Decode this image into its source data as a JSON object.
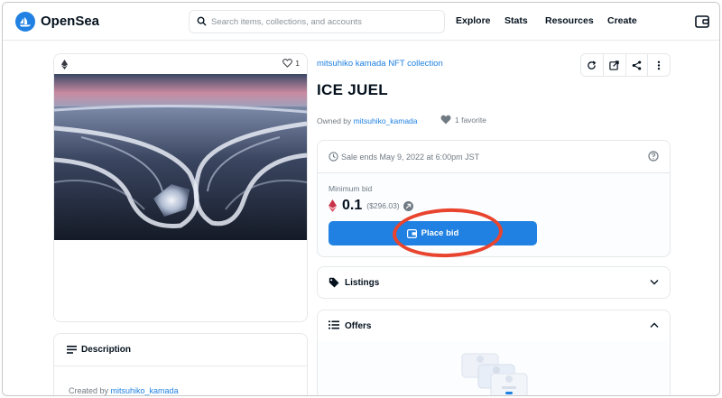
{
  "header": {
    "brand": "OpenSea",
    "search_placeholder": "Search items, collections, and accounts",
    "nav": [
      "Explore",
      "Stats",
      "Resources",
      "Create"
    ]
  },
  "media": {
    "favorite_count": "1"
  },
  "item": {
    "collection": "mitsuhiko kamada NFT collection",
    "title": "ICE JUEL",
    "owned_prefix": "Owned by ",
    "owner": "mitsuhiko_kamada",
    "favorites": "1 favorite"
  },
  "sale": {
    "ends": "Sale ends May 9, 2022 at 6:00pm JST",
    "min_bid_label": "Minimum bid",
    "price": "0.1",
    "usd": "($296.03)",
    "place_bid": "Place bid"
  },
  "sections": {
    "listings": "Listings",
    "offers": "Offers",
    "description": "Description"
  },
  "description": {
    "created_prefix": "Created by ",
    "creator": "mitsuhiko_kamada"
  },
  "colors": {
    "accent": "#2081e2",
    "highlight": "#e8442e"
  }
}
